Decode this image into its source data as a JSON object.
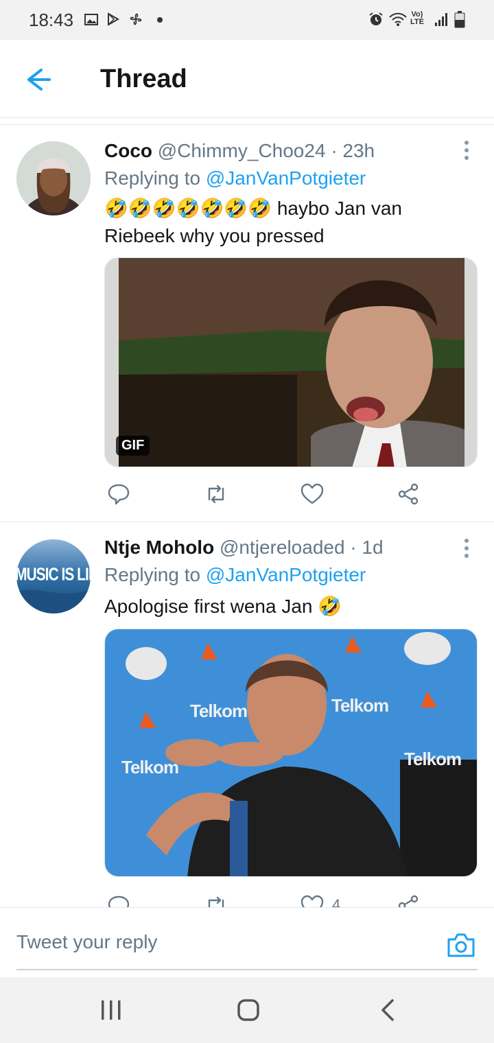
{
  "status_bar": {
    "time": "18:43",
    "icons": [
      "gallery-icon",
      "play-store-icon",
      "fan-icon",
      "dot-icon",
      "alarm-icon",
      "wifi-icon",
      "volte-icon",
      "signal-icon",
      "battery-icon"
    ],
    "lte_top": "Vo)",
    "lte_bottom": "LTE"
  },
  "header": {
    "title": "Thread",
    "accent": "#1da1f2"
  },
  "tweets": [
    {
      "display_name": "Coco",
      "handle": "@Chimmy_Choo24",
      "time": "· 23h",
      "replying_label": "Replying to",
      "replying_to": "@JanVanPotgieter",
      "text_line1": "🤣🤣🤣🤣🤣🤣🤣 haybo Jan van",
      "text_line2": "Riebeek why you pressed",
      "media_badge": "GIF"
    },
    {
      "display_name": "Ntje Moholo",
      "handle": "@ntjereloaded",
      "time": "· 1d",
      "replying_label": "Replying to",
      "replying_to": "@JanVanPotgieter",
      "text_line1": "Apologise first wena Jan 🤣",
      "avatar_text": "MUSIC IS LIFE",
      "like_count": "4",
      "banner_words": [
        "Telkom",
        "Telkom",
        "Telkom",
        "Telkom"
      ]
    }
  ],
  "composer": {
    "placeholder": "Tweet your reply"
  },
  "colors": {
    "link": "#1da1f2",
    "secondary_text": "#657786",
    "divider": "#e1e8ed"
  }
}
